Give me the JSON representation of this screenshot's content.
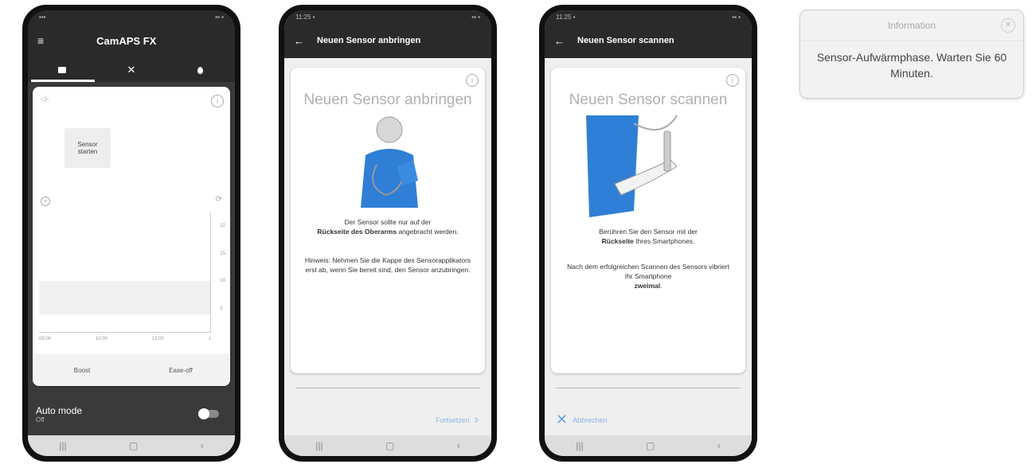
{
  "phone1": {
    "app_title": "CamAPS FX",
    "menu_icon": "hamburger-icon",
    "tabs": [
      {
        "icon": "home-icon",
        "glyph": "🏠"
      },
      {
        "icon": "cutlery-icon",
        "glyph": "✕"
      },
      {
        "icon": "drop-icon",
        "glyph": "💧"
      }
    ],
    "sensor_button_line1": "Sensor",
    "sensor_button_line2": "starten",
    "y_ticks": [
      "22",
      "15",
      "10",
      "5"
    ],
    "x_ticks": [
      "08:00",
      "10:00",
      "12:00",
      "1"
    ],
    "boost_label": "Boost",
    "easeoff_label": "Ease-off",
    "auto_mode_label": "Auto mode",
    "auto_mode_state": "Off"
  },
  "phone2": {
    "appbar_title": "Neuen Sensor anbringen",
    "card_title": "Neuen Sensor anbringen",
    "text1_pre": "Der Sensor sollte nur auf der",
    "text1_bold": "Rückseite des Oberarms",
    "text1_post": "angebracht werden.",
    "text2": "Hinweis: Nehmen Sie die Kappe des Sensorapplikators erst ab, wenn Sie bereit sind, den Sensor anzubringen.",
    "continue_label": "Fortsetzen"
  },
  "phone3": {
    "appbar_title": "Neuen Sensor scannen",
    "card_title": "Neuen Sensor scannen",
    "text1_pre": "Berühren Sie den Sensor mit der",
    "text1_bold": "Rückseite",
    "text1_post": "Ihres Smartphones.",
    "text2_pre": "Nach dem erfolgreichen Scannen des Sensors vibriert Ihr Smartphone",
    "text2_bold": "zweimal",
    "cancel_label": "Abbrechen"
  },
  "dialog": {
    "title": "Information",
    "message": "Sensor-Aufwärmphase. Warten Sie 60 Minuten."
  },
  "colors": {
    "accent": "#2f7fd6",
    "dark_bar": "#2a2a2a"
  }
}
